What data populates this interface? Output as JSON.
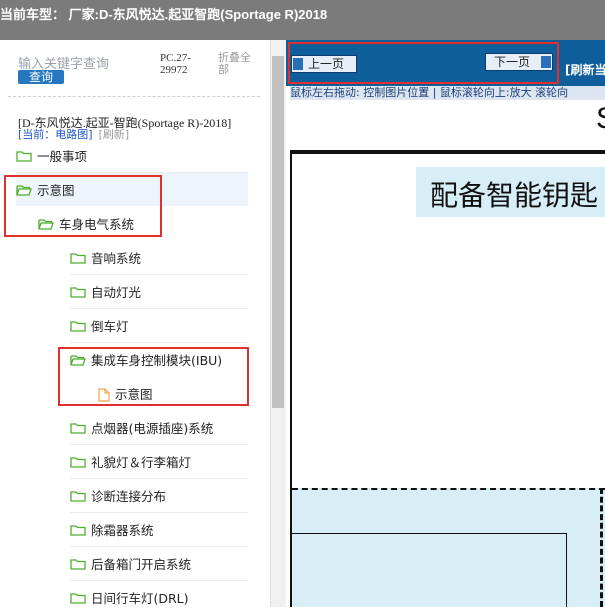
{
  "titlebar": {
    "text": "当前车型：  厂家:D-东风悦达.起亚智跑(Sportage R)2018"
  },
  "left": {
    "search_placeholder": "输入关键字查询",
    "query_label": "查询",
    "pc_code": "PC.27-29972",
    "collapse_all": "折叠全部",
    "vehicle": "[D-东风悦达.起亚-智跑(Sportage R)-2018]",
    "current_label": "[当前：",
    "current_value": "电路图]",
    "refresh_label": "[刷新]",
    "tree": [
      {
        "label": "一般事项",
        "type": "folder-closed"
      },
      {
        "label": "示意图",
        "type": "folder-open"
      },
      {
        "label": "车身电气系统",
        "type": "folder-open"
      },
      {
        "label": "音响系统",
        "type": "folder-closed"
      },
      {
        "label": "自动灯光",
        "type": "folder-closed"
      },
      {
        "label": "倒车灯",
        "type": "folder-closed"
      },
      {
        "label": "集成车身控制模块(IBU)",
        "type": "folder-open"
      },
      {
        "label": "示意图",
        "type": "document"
      },
      {
        "label": "点烟器(电源插座)系统",
        "type": "folder-closed"
      },
      {
        "label": "礼貌灯＆行李箱灯",
        "type": "folder-closed"
      },
      {
        "label": "诊断连接分布",
        "type": "folder-closed"
      },
      {
        "label": "除霜器系统",
        "type": "folder-closed"
      },
      {
        "label": "后备箱门开启系统",
        "type": "folder-closed"
      },
      {
        "label": "日间行车灯(DRL)",
        "type": "folder-closed"
      }
    ]
  },
  "right": {
    "prev_label": "上一页",
    "next_label": "下一页",
    "refresh_current": "[刷新当",
    "hint": "鼠标左右拖动: 控制图片位置 | 鼠标滚轮向上:放大  滚轮向",
    "page_letter": "S",
    "diagram_title": "配备智能钥匙"
  },
  "colors": {
    "titlebar_bg": "#7b7b7b",
    "navbar_bg": "#0f5e9c",
    "query_button": "#2577c0",
    "highlight_box": "#e0302e",
    "diagram_fill": "#d7eef6"
  }
}
